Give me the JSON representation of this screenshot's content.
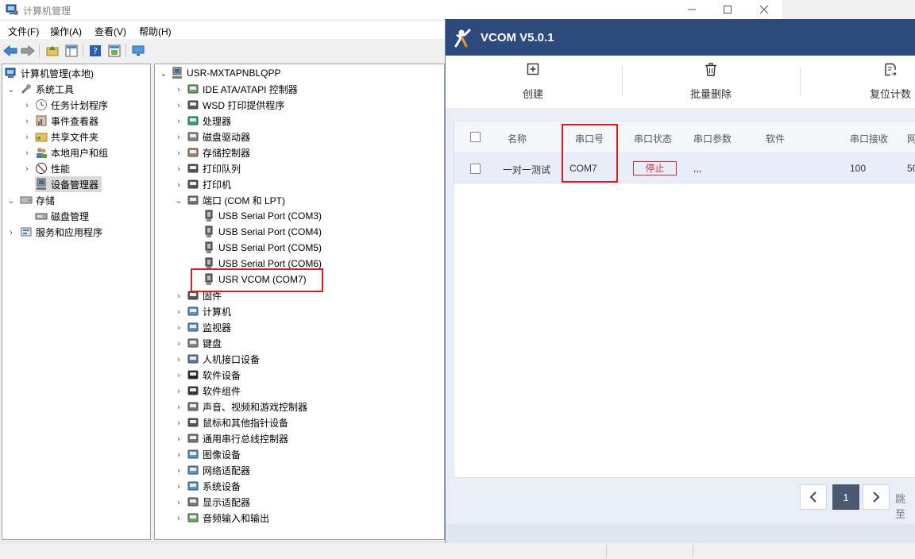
{
  "cm": {
    "title": "计算机管理",
    "menu": [
      "文件(F)",
      "操作(A)",
      "查看(V)",
      "帮助(H)"
    ],
    "left_tree": {
      "root": "计算机管理(本地)",
      "system_tools": "系统工具",
      "task_scheduler": "任务计划程序",
      "event_viewer": "事件查看器",
      "shared_folders": "共享文件夹",
      "local_users": "本地用户和组",
      "performance": "性能",
      "device_manager": "设备管理器",
      "storage": "存储",
      "disk_management": "磁盘管理",
      "services": "服务和应用程序"
    },
    "device_tree": {
      "computer": "USR-MXTAPNBLQPP",
      "categories": [
        "IDE ATA/ATAPI 控制器",
        "WSD 打印提供程序",
        "处理器",
        "磁盘驱动器",
        "存储控制器",
        "打印队列",
        "打印机",
        "端口 (COM 和 LPT)"
      ],
      "ports": [
        "USB Serial Port (COM3)",
        "USB Serial Port (COM4)",
        "USB Serial Port (COM5)",
        "USB Serial Port (COM6)",
        "USR VCOM (COM7)"
      ],
      "categories2": [
        "固件",
        "计算机",
        "监视器",
        "键盘",
        "人机接口设备",
        "软件设备",
        "软件组件",
        "声音、视频和游戏控制器",
        "鼠标和其他指针设备",
        "通用串行总线控制器",
        "图像设备",
        "网络适配器",
        "系统设备",
        "显示适配器",
        "音频输入和输出"
      ]
    }
  },
  "vcom": {
    "title": "VCOM V5.0.1",
    "toolbar": {
      "create": "创建",
      "batch_delete": "批量删除",
      "reset_count": "复位计数"
    },
    "table": {
      "headers": {
        "name": "名称",
        "port": "串口号",
        "status": "串口状态",
        "params": "串口参数",
        "software": "软件",
        "recv": "串口接收",
        "net": "网"
      },
      "row": {
        "name": "一对一测试",
        "port": "COM7",
        "status": "停止",
        "params": ",,,",
        "software": "",
        "recv": "100",
        "net": "50"
      }
    },
    "pagination": {
      "page": "1",
      "goto": "跳至"
    }
  },
  "colors": {
    "vcom_header": "#2c4a7c",
    "highlight": "#e41b1b",
    "page_active": "#4a5872"
  }
}
